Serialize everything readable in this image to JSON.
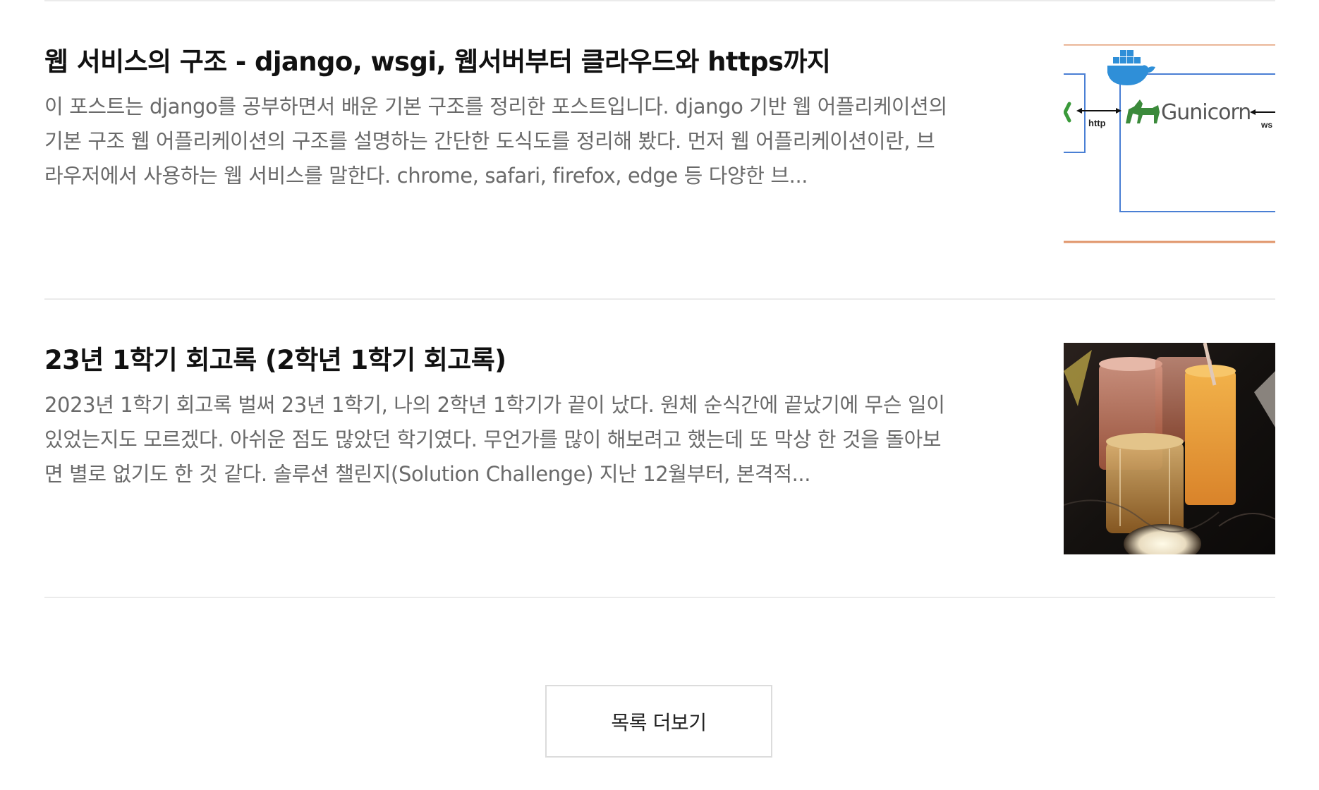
{
  "posts": [
    {
      "title": "웹 서비스의 구조 - django,  wsgi, 웹서버부터 클라우드와 https까지",
      "summary": "이 포스트는 django를 공부하면서 배운 기본 구조를 정리한 포스트입니다. django 기반 웹 어플리케이션의 기본 구조 웹 어플리케이션의 구조를 설명하는 간단한 도식도를 정리해 봤다. 먼저 웹 어플리케이션이란, 브라우저에서 사용하는 웹 서비스를 말한다. chrome, safari, firefox, edge 등 다양한 브...",
      "thumbnail": {
        "label_http": "http",
        "label_gunicorn": "Gunicorn",
        "label_ws": "ws",
        "icons": [
          "docker-whale-icon",
          "gunicorn-unicorn-icon"
        ]
      }
    },
    {
      "title": "23년 1학기 회고록 (2학년 1학기 회고록)",
      "summary": "2023년 1학기 회고록 벌써 23년 1학기, 나의 2학년 1학기가 끝이 났다. 원체 순식간에 끝났기에 무슨 일이 있었는지도 모르겠다. 아쉬운 점도 많았던 학기였다. 무언가를 많이 해보려고 했는데 또 막상 한 것을 돌아보면 별로 없기도 한 것 같다. 솔루션 챌린지(Solution Challenge) 지난 12월부터, 본격적...",
      "thumbnail": {
        "description_colors": [
          "#1a1614",
          "#e8a23a",
          "#c9705a",
          "#d9b36c"
        ]
      }
    }
  ],
  "more_button": {
    "label": "목록 더보기"
  },
  "colors": {
    "title": "#111111",
    "summary": "#6a6a6a",
    "divider": "#ebebeb",
    "diagram_blue": "#4a7fd4",
    "diagram_orange": "#e0956a",
    "gunicorn_green": "#3b8a3b"
  }
}
